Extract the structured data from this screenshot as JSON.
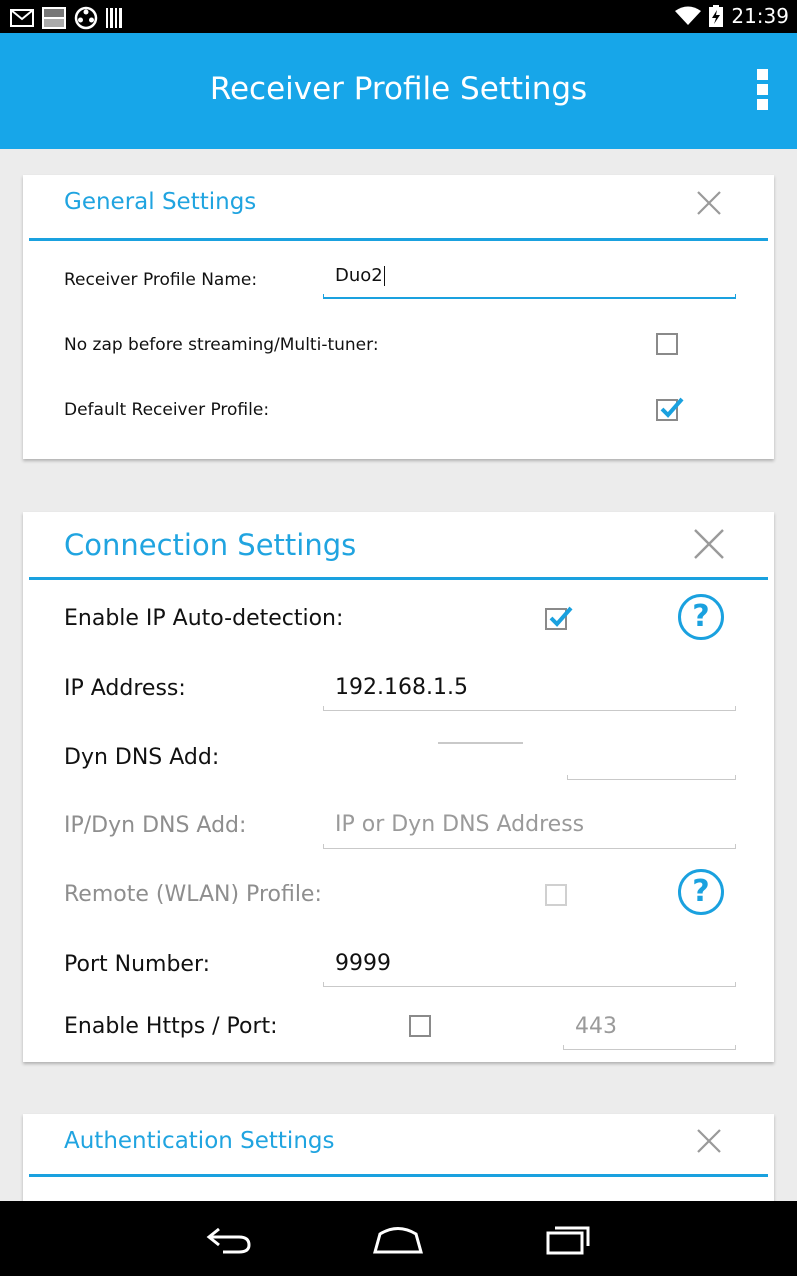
{
  "status_bar": {
    "time": "21:39",
    "notification_icons": [
      "gmail-icon",
      "basic4android-icon",
      "film-reel-icon",
      "barcode-icon"
    ],
    "status_icons": [
      "wifi-icon",
      "battery-charging-icon"
    ]
  },
  "action_bar": {
    "title": "Receiver Profile Settings",
    "overflow_icon": "overflow-menu-icon"
  },
  "general": {
    "title": "General Settings",
    "profile_name_label": "Receiver Profile Name:",
    "profile_name_value": "Duo2",
    "no_zap_label": "No zap before streaming/Multi-tuner:",
    "no_zap_checked": false,
    "default_label": "Default Receiver Profile:",
    "default_checked": true
  },
  "connection": {
    "title": "Connection Settings",
    "auto_detect_label": "Enable IP Auto-detection:",
    "auto_detect_checked": true,
    "ip_label": "IP Address:",
    "ip_value": "192.168.1.5",
    "dyn_dns_label": "Dyn DNS Add:",
    "dyn_dns_value": "",
    "ip_dyn_label": "IP/Dyn DNS Add:",
    "ip_dyn_placeholder": "IP or Dyn DNS Address",
    "remote_label": "Remote (WLAN) Profile:",
    "remote_checked": false,
    "port_label": "Port Number:",
    "port_value": "9999",
    "https_label": "Enable Https / Port:",
    "https_checked": false,
    "https_port_placeholder": "443",
    "help_symbol": "?"
  },
  "authentication": {
    "title": "Authentication Settings"
  },
  "colors": {
    "accent": "#17a6e9",
    "background": "#ececec"
  }
}
